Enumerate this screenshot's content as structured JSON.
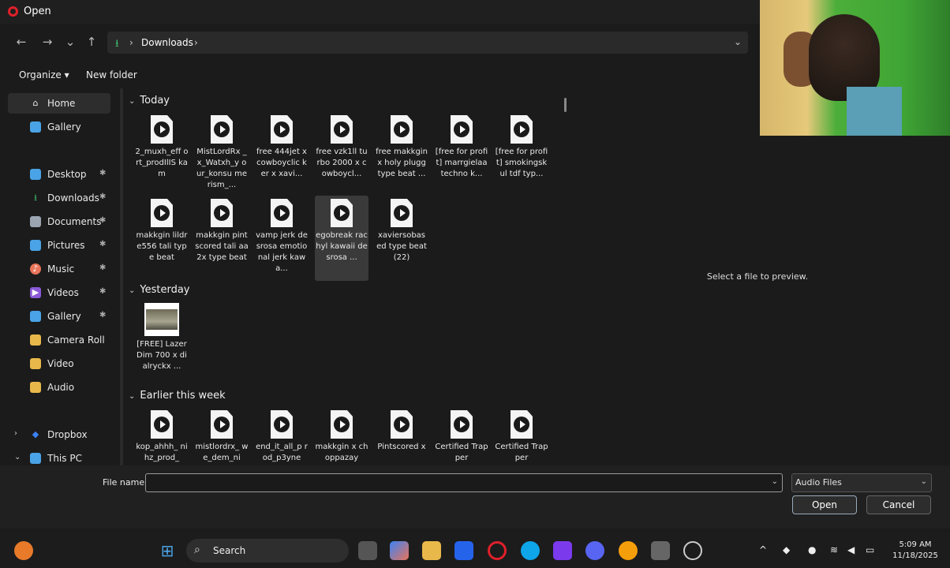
{
  "window": {
    "title": "Open",
    "accent": "#e0202a"
  },
  "nav": {
    "back": "←",
    "forward": "→",
    "recent": "⌄",
    "up": "↑"
  },
  "address": {
    "location": "Downloads",
    "sep": "›"
  },
  "commands": {
    "organize": "Organize ▾",
    "new_folder": "New folder"
  },
  "sidebar": {
    "items": [
      {
        "label": "Home",
        "icon": "⌂",
        "color": "#e8e8e8"
      },
      {
        "label": "Gallery",
        "icon": "▣",
        "color": "#4aa3e6"
      },
      {
        "label": "Desktop",
        "icon": "▬",
        "color": "#4aa3e6"
      },
      {
        "label": "Downloads",
        "icon": "⭳",
        "color": "#3fbf6f"
      },
      {
        "label": "Documents",
        "icon": "▤",
        "color": "#9aa5b1"
      },
      {
        "label": "Pictures",
        "icon": "▧",
        "color": "#4aa3e6"
      },
      {
        "label": "Music",
        "icon": "♪",
        "color": "#e8745a"
      },
      {
        "label": "Videos",
        "icon": "▶",
        "color": "#8a5ad8"
      },
      {
        "label": "Gallery",
        "icon": "▣",
        "color": "#4aa3e6"
      },
      {
        "label": "Camera Roll",
        "icon": "▆",
        "color": "#e8b84a"
      },
      {
        "label": "Video",
        "icon": "▆",
        "color": "#e8b84a"
      },
      {
        "label": "Audio",
        "icon": "▆",
        "color": "#e8b84a"
      },
      {
        "label": "Dropbox",
        "icon": "◆",
        "color": "#3b82f6"
      },
      {
        "label": "This PC",
        "icon": "▭",
        "color": "#4aa3e6"
      }
    ]
  },
  "groups": {
    "today": "Today",
    "yesterday": "Yesterday",
    "earlier": "Earlier this week"
  },
  "files": {
    "today_row1": [
      "2_muxh_eff ort_prodIlIS kam",
      "MistLordRx _x_Watxh_y our_konsu merism_...",
      "free 444jet x cowboyclic ker x xavi...",
      "free vzk1ll turbo 2000 x cowboycl...",
      "free makkgin x holy plugg type beat ...",
      "[free for profit] marrgielaa techno k...",
      "[free for profit] smokingsk ul tdf typ..."
    ],
    "today_row2": [
      "makkgin lildre556 tali type beat",
      "makkgin pintscored tali aa2x type beat",
      "vamp jerk desrosa emotional jerk kawa...",
      "egobreak rachyl kawaii desrosa ...",
      "xaviersobas ed type beat (22)"
    ],
    "yesterday": [
      "[FREE] Lazer Dim 700 x dialryckx ..."
    ],
    "earlier": [
      "kop_ahhh_ nihz_prod_",
      "mistlordrx_ we_dem_ni",
      "end_it_all_p rod_p3yne",
      "makkgin x choppazay",
      "Pintscored x",
      "Certified Trapper",
      "Certified Trapper"
    ]
  },
  "preview": {
    "message": "Select a file to preview."
  },
  "footer": {
    "file_name_label": "File name:",
    "file_name_value": "",
    "filter": "Audio Files",
    "open": "Open",
    "cancel": "Cancel"
  },
  "taskbar": {
    "search": "Search",
    "time": "5:09 AM",
    "date": "11/18/2025"
  }
}
